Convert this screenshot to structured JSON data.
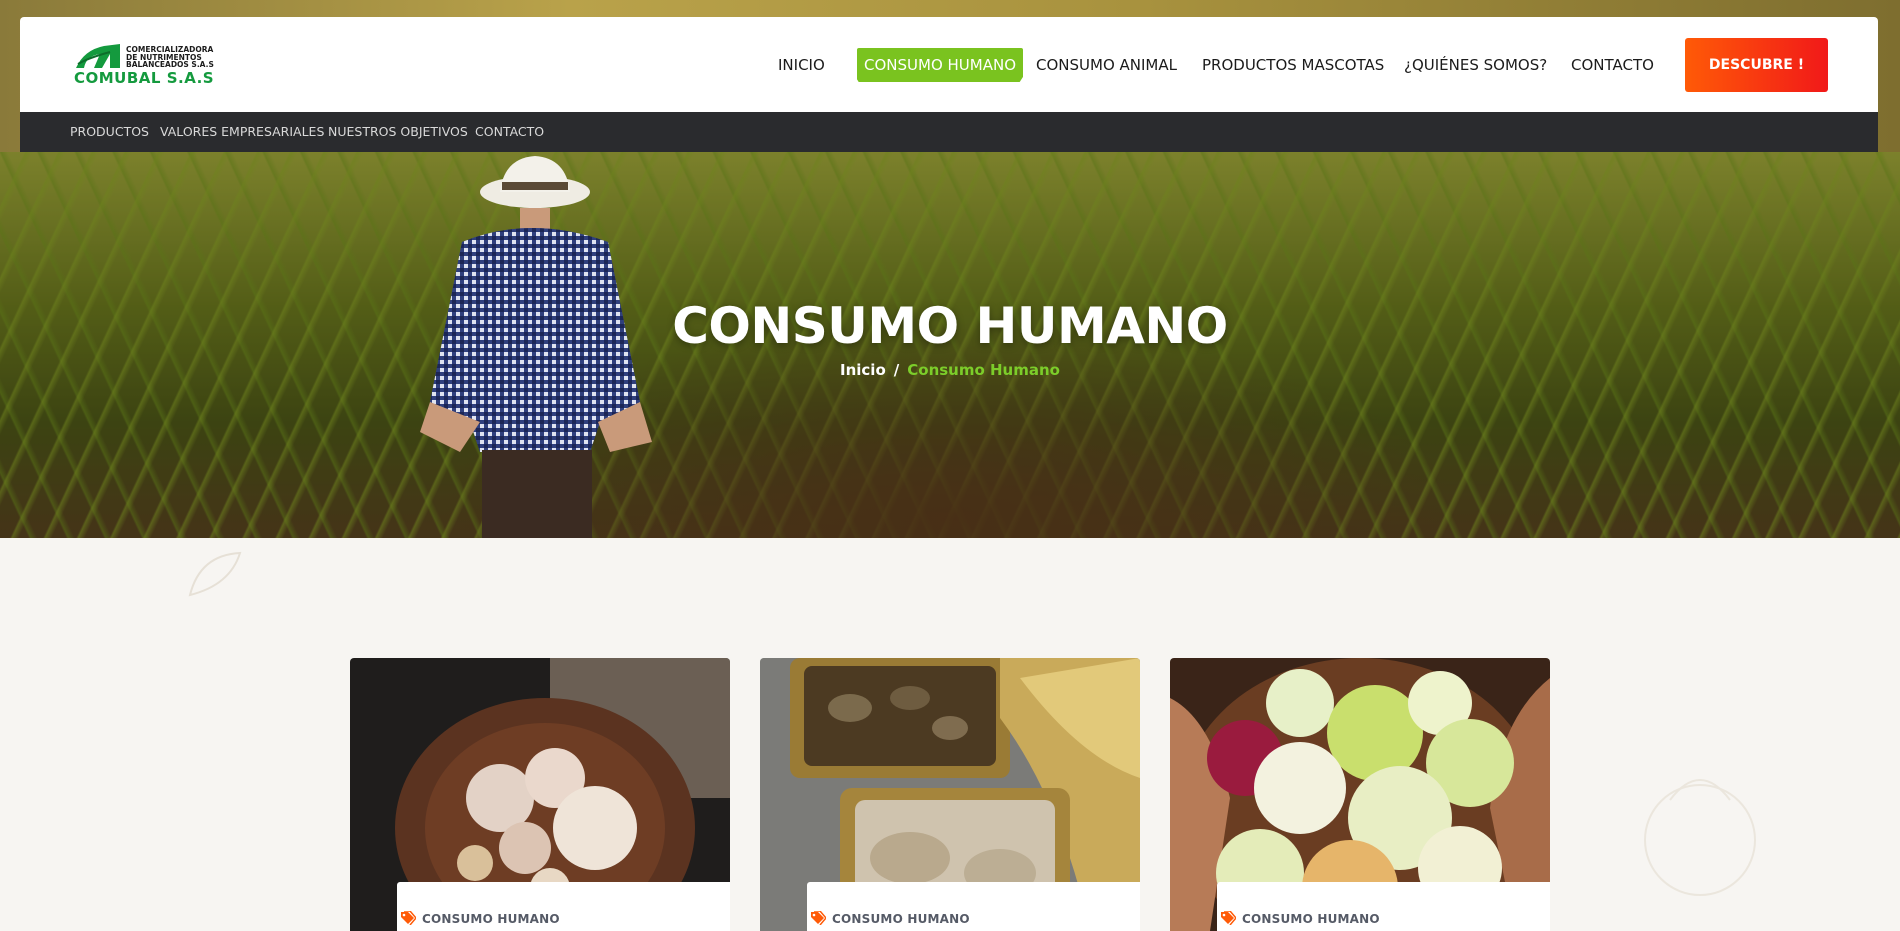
{
  "brand": {
    "logo_line1": "COMERCIALIZADORA",
    "logo_line2": "DE NUTRIMENTOS",
    "logo_line3": "BALANCEADOS S.A.S",
    "logo_name": "COMUBAL S.A.S",
    "green": "#149a3e"
  },
  "nav": {
    "items": [
      {
        "label": "INICIO"
      },
      {
        "label": "CONSUMO HUMANO"
      },
      {
        "label": "CONSUMO ANIMAL"
      },
      {
        "label": "PRODUCTOS MASCOTAS"
      },
      {
        "label": "¿QUIÉNES SOMOS?"
      },
      {
        "label": "CONTACTO"
      }
    ],
    "active_color": "#7ac31f",
    "cta_label": "DESCUBRE !"
  },
  "subnav": {
    "items": [
      {
        "label": "PRODUCTOS"
      },
      {
        "label": "VALORES EMPRESARIALES"
      },
      {
        "label": "NUESTROS OBJETIVOS"
      },
      {
        "label": "CONTACTO"
      }
    ]
  },
  "hero": {
    "title": "CONSUMO HUMANO",
    "breadcrumb_home": "Inicio",
    "breadcrumb_sep": "/",
    "breadcrumb_current": "Consumo Humano"
  },
  "cards": [
    {
      "image": "garlic-photo",
      "tag": "CONSUMO HUMANO"
    },
    {
      "image": "canned-fish-photo",
      "tag": "CONSUMO HUMANO"
    },
    {
      "image": "onions-photo",
      "tag": "CONSUMO HUMANO"
    }
  ]
}
